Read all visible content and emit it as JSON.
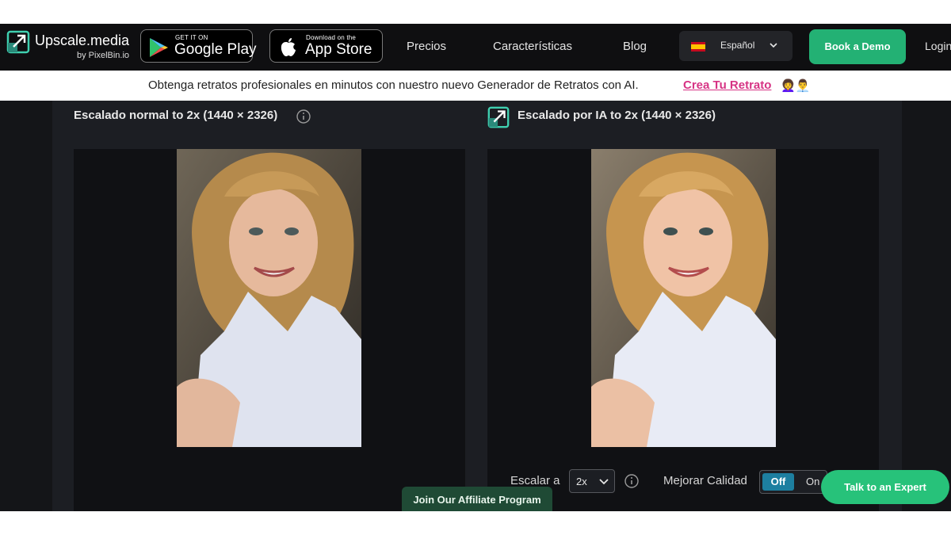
{
  "nav": {
    "brand": "Upscale.media",
    "brand_sub": "by PixelBin.io",
    "google_play": {
      "small": "GET IT ON",
      "big": "Google Play"
    },
    "app_store": {
      "small": "Download on the",
      "big": "App Store"
    },
    "links": [
      "Precios",
      "Características",
      "Blog"
    ],
    "language": "Español",
    "demo_button": "Book a Demo",
    "login": "Login"
  },
  "banner": {
    "text": "Obtenga retratos profesionales en minutos con nuestro nuevo Generador de Retratos con AI.",
    "link": "Crea Tu Retrato",
    "emoji": "👩‍🦱👨‍💼"
  },
  "compare": {
    "left_title": "Escalado normal to 2x (1440 × 2326)",
    "right_title": "Escalado por IA to 2x (1440 × 2326)"
  },
  "controls": {
    "scale_label": "Escalar a",
    "scale_value": "2x",
    "quality_label": "Mejorar Calidad",
    "toggle_off": "Off",
    "toggle_on": "On",
    "toggle_state": "Off"
  },
  "footer": {
    "affiliate": "Join Our Affiliate Program",
    "expert": "Talk to an Expert"
  },
  "colors": {
    "nav_bg": "#0f0f11",
    "accent_green": "#23b174",
    "link_pink": "#d63384",
    "toggle_blue": "#1d7fa0"
  }
}
